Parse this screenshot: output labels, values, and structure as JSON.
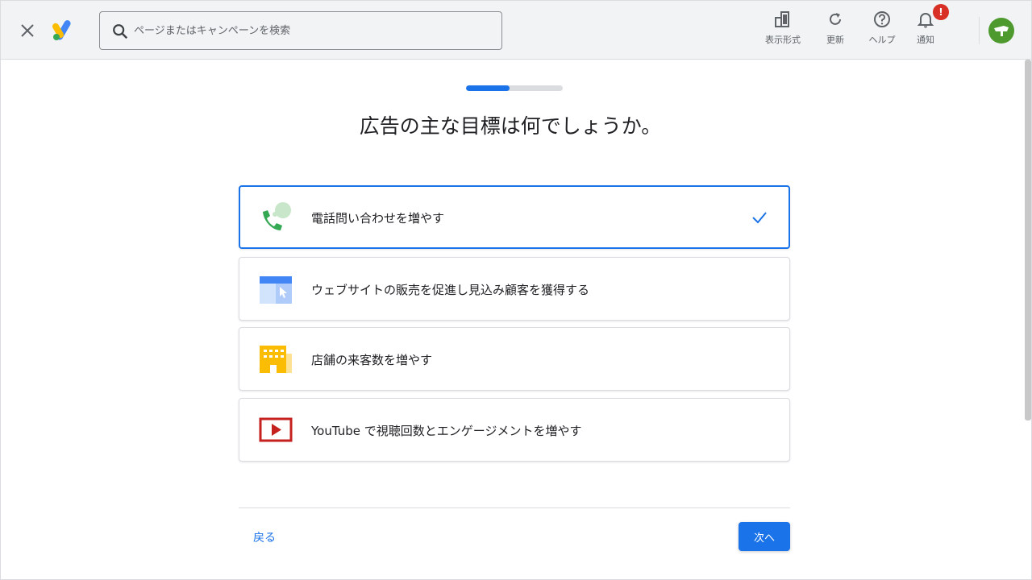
{
  "topbar": {
    "search_placeholder": "ページまたはキャンペーンを検索",
    "tools": {
      "view": "表示形式",
      "refresh": "更新",
      "help": "ヘルプ",
      "notifications": "通知",
      "notification_badge": "!"
    }
  },
  "progress": {
    "fraction": 0.45
  },
  "main": {
    "title": "広告の主な目標は何でしょうか。",
    "options": [
      {
        "label": "電話問い合わせを増やす",
        "icon": "phone-call-icon",
        "selected": true
      },
      {
        "label": "ウェブサイトの販売を促進し見込み顧客を獲得する",
        "icon": "website-icon",
        "selected": false
      },
      {
        "label": "店舗の来客数を増やす",
        "icon": "store-icon",
        "selected": false
      },
      {
        "label": "YouTube で視聴回数とエンゲージメントを増やす",
        "icon": "youtube-icon",
        "selected": false
      }
    ]
  },
  "footer": {
    "back_label": "戻る",
    "next_label": "次へ"
  },
  "colors": {
    "accent": "#1a73e8",
    "topbar_bg": "#f1f3f4",
    "badge": "#d93025",
    "avatar": "#4e9a2f"
  }
}
